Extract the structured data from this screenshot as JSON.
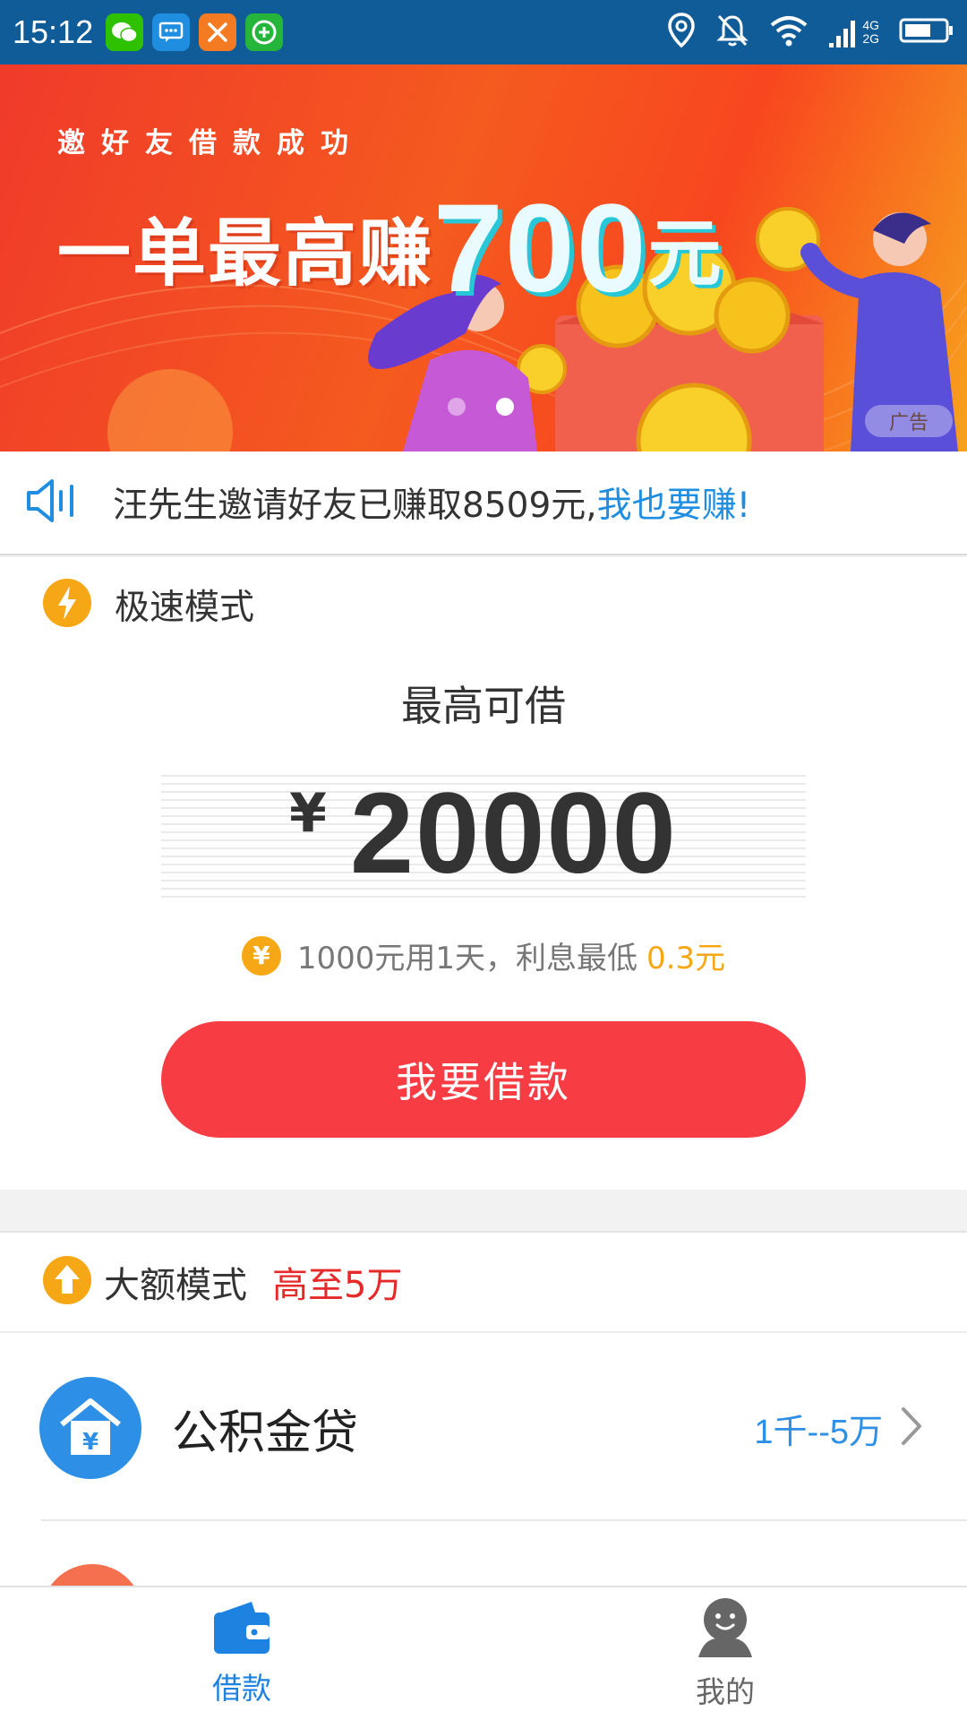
{
  "status_bar": {
    "time": "15:12",
    "notification_icons": [
      "wechat-icon",
      "message-icon",
      "tools-icon",
      "add-icon"
    ],
    "signal_labels": [
      "4G",
      "2G"
    ]
  },
  "banner": {
    "subtitle": "邀好友借款成功",
    "headline_prefix": "一单最高赚",
    "headline_number": "700",
    "headline_unit": "元",
    "ad_label": "广告",
    "slide_index": 2,
    "slide_count": 2
  },
  "notice": {
    "text": "汪先生邀请好友已赚取8509元,",
    "link_text": "我也要赚!"
  },
  "fast_mode": {
    "label": "极速模式",
    "max_label": "最高可借",
    "currency": "¥",
    "amount": "20000",
    "interest_text": "1000元用1天，利息最低 ",
    "interest_highlight": "0.3元",
    "borrow_button": "我要借款"
  },
  "large_mode": {
    "label": "大额模式",
    "highlight": "高至5万",
    "products": [
      {
        "name": "公积金贷",
        "range": "1千--5万"
      }
    ]
  },
  "bottom_nav": {
    "items": [
      {
        "label": "借款",
        "icon": "wallet-icon",
        "active": true
      },
      {
        "label": "我的",
        "icon": "profile-icon",
        "active": false
      }
    ]
  },
  "colors": {
    "status_bar": "#0f5c98",
    "primary_red": "#f73d43",
    "link_blue": "#1f8ee0",
    "accent_orange": "#f6a715",
    "highlight_red": "#e62a2a"
  }
}
